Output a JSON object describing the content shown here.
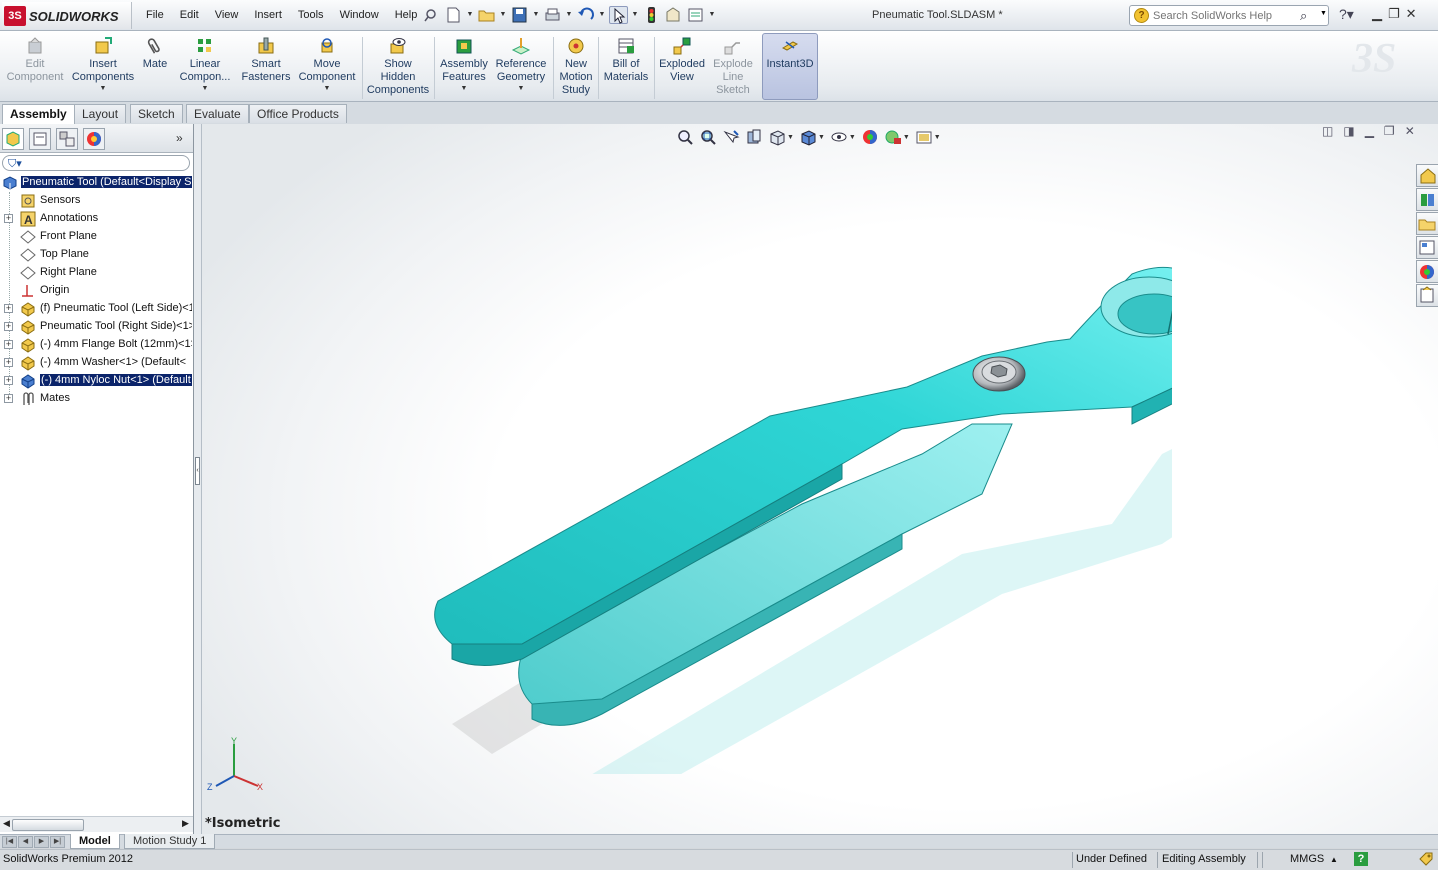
{
  "app": {
    "logo_badge": "3S",
    "logo_text": "SOLIDWORKS",
    "document_title": "Pneumatic Tool.SLDASM *"
  },
  "menus": [
    "File",
    "Edit",
    "View",
    "Insert",
    "Tools",
    "Window",
    "Help"
  ],
  "search": {
    "placeholder": "Search SolidWorks Help"
  },
  "ribbon": {
    "buttons": [
      {
        "label": "Edit\nComponent",
        "enabled": false
      },
      {
        "label": "Insert\nComponents",
        "enabled": true
      },
      {
        "label": "Mate",
        "enabled": true
      },
      {
        "label": "Linear\nCompon...",
        "enabled": true
      },
      {
        "label": "Smart\nFasteners",
        "enabled": true
      },
      {
        "label": "Move\nComponent",
        "enabled": true
      },
      {
        "label": "Show\nHidden\nComponents",
        "enabled": true
      },
      {
        "label": "Assembly\nFeatures",
        "enabled": true
      },
      {
        "label": "Reference\nGeometry",
        "enabled": true
      },
      {
        "label": "New\nMotion\nStudy",
        "enabled": true
      },
      {
        "label": "Bill of\nMaterials",
        "enabled": true
      },
      {
        "label": "Exploded\nView",
        "enabled": true
      },
      {
        "label": "Explode\nLine\nSketch",
        "enabled": false
      },
      {
        "label": "Instant3D",
        "enabled": true
      }
    ]
  },
  "tabs": [
    "Assembly",
    "Layout",
    "Sketch",
    "Evaluate",
    "Office Products"
  ],
  "tree": {
    "root": "Pneumatic Tool  (Default<Display S",
    "items": [
      "Sensors",
      "Annotations",
      "Front Plane",
      "Top Plane",
      "Right Plane",
      "Origin",
      "(f) Pneumatic Tool (Left Side)<1",
      "Pneumatic Tool (Right Side)<1>",
      "(-) 4mm Flange Bolt (12mm)<1>",
      "(-) 4mm Washer<1> (Default<",
      "(-) 4mm Nyloc Nut<1> (Default",
      "Mates"
    ]
  },
  "viewport": {
    "view_name": "*Isometric",
    "triad": {
      "x": "X",
      "y": "Y",
      "z": "Z"
    }
  },
  "bottom_tabs": [
    "Model",
    "Motion Study 1"
  ],
  "status": {
    "product": "SolidWorks Premium 2012",
    "definition": "Under Defined",
    "mode": "Editing Assembly",
    "units": "MMGS",
    "units_arrow": "▲",
    "help": "?"
  },
  "colors": {
    "part_cyan": "#2ccdcd",
    "part_dark": "#1aa6a6",
    "selection_blue": "#0b246a",
    "brand_red": "#c8102e"
  }
}
